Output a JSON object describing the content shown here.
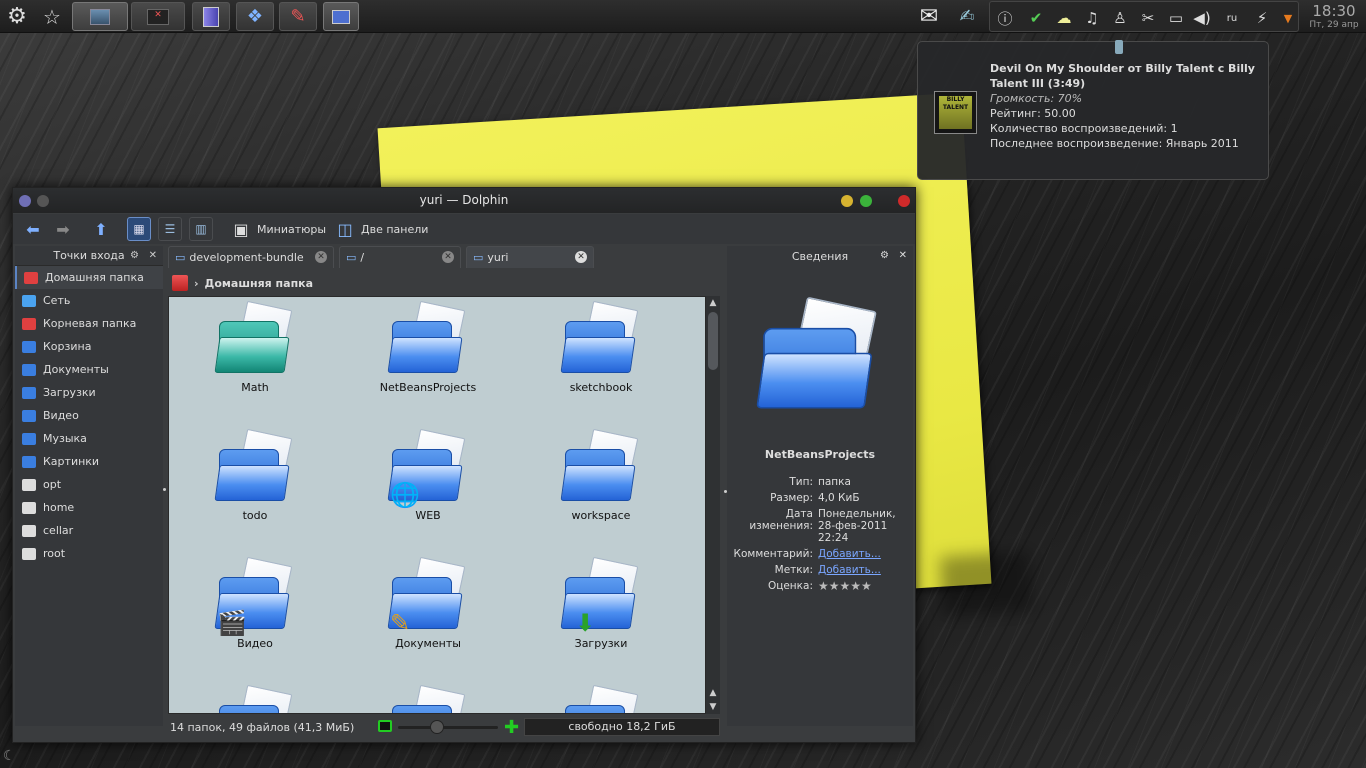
{
  "panel": {
    "tasks": [
      "desktop-task",
      "terminal-task",
      "cube-app",
      "network-app",
      "system-app",
      "display-app"
    ],
    "tray_keyboard": "ru",
    "clock_time": "18:30",
    "clock_date": "Пт, 29 апр"
  },
  "notification": {
    "title": "Devil On My Shoulder от Billy Talent с Billy Talent III (3:49)",
    "volume": "Громкость: 70%",
    "rating": "Рейтинг: 50.00",
    "plays": "Количество воспроизведений: 1",
    "last_played": "Последнее воспроизведение: Январь 2011",
    "cover_text": "BILLY TALENT"
  },
  "window": {
    "title": "yuri — Dolphin",
    "toolbar": {
      "thumbnails": "Миниатюры",
      "split": "Две панели"
    },
    "places": {
      "title": "Точки входа",
      "items": [
        {
          "label": "Домашняя папка",
          "color": "#e04040"
        },
        {
          "label": "Сеть",
          "color": "#4aa3f0"
        },
        {
          "label": "Корневая папка",
          "color": "#e04040"
        },
        {
          "label": "Корзина",
          "color": "#3a7ee0"
        },
        {
          "label": "Документы",
          "color": "#3a7ee0"
        },
        {
          "label": "Загрузки",
          "color": "#3a7ee0"
        },
        {
          "label": "Видео",
          "color": "#3a7ee0"
        },
        {
          "label": "Музыка",
          "color": "#3a7ee0"
        },
        {
          "label": "Картинки",
          "color": "#3a7ee0"
        },
        {
          "label": "opt",
          "color": "#dddddd"
        },
        {
          "label": "home",
          "color": "#dddddd"
        },
        {
          "label": "cellar",
          "color": "#dddddd"
        },
        {
          "label": "root",
          "color": "#dddddd"
        }
      ]
    },
    "tabs": [
      "development-bundle",
      "/",
      "yuri"
    ],
    "breadcrumb": "Домашняя папка",
    "files": [
      "Math",
      "NetBeansProjects",
      "sketchbook",
      "todo",
      "WEB",
      "workspace",
      "Видео",
      "Документы",
      "Загрузки"
    ],
    "info": {
      "title": "Сведения",
      "name": "NetBeansProjects",
      "type_k": "Тип:",
      "type_v": "папка",
      "size_k": "Размер:",
      "size_v": "4,0 КиБ",
      "date_k": "Дата изменения:",
      "date_v": "Понедельник, 28-фев-2011 22:24",
      "comment_k": "Комментарий:",
      "comment_v": "Добавить...",
      "tags_k": "Метки:",
      "tags_v": "Добавить...",
      "rating_k": "Оценка:",
      "stars": "★★★★★"
    },
    "status": {
      "summary": "14 папок, 49 файлов (41,3 МиБ)",
      "free": "свободно 18,2 ГиБ"
    }
  }
}
